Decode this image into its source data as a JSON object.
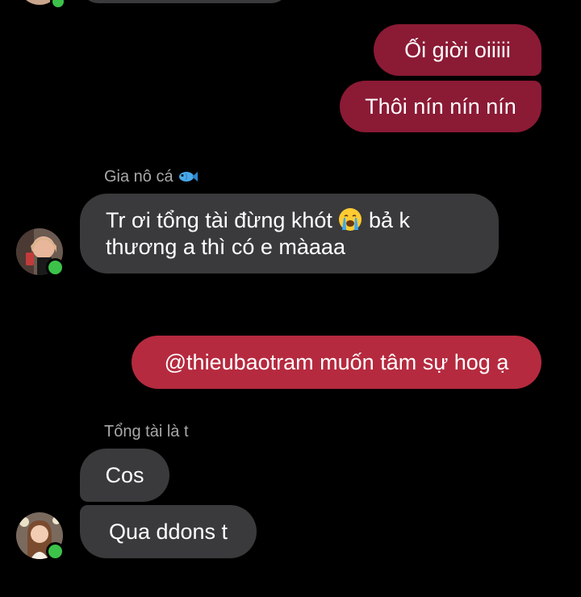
{
  "colors": {
    "background": "#000000",
    "outgoing_bubble": "#8b1a35",
    "outgoing_mention_bubble": "#b52a3f",
    "incoming_bubble": "#3a3a3c",
    "sender_name": "#a8a8a8",
    "online_dot": "#3cc24a"
  },
  "messages": {
    "out_1": "Ối giời oiiiii",
    "out_2": "Thôi nín nín nín",
    "group_1": {
      "sender": "Gia nô cá",
      "sender_emoji": "fish-emoji",
      "text_line1": "Tr ơi tổng tài đừng khót",
      "text_emoji": "loudly-crying-face-emoji",
      "text_line1_end": "bả k",
      "text_line2": "thương a thì có e màaaa"
    },
    "out_3": "@thieubaotram muốn tâm sự hog ạ",
    "group_2": {
      "sender": "Tổng tài là t",
      "msg_1": "Cos",
      "msg_2": "Qua ddons t"
    }
  }
}
